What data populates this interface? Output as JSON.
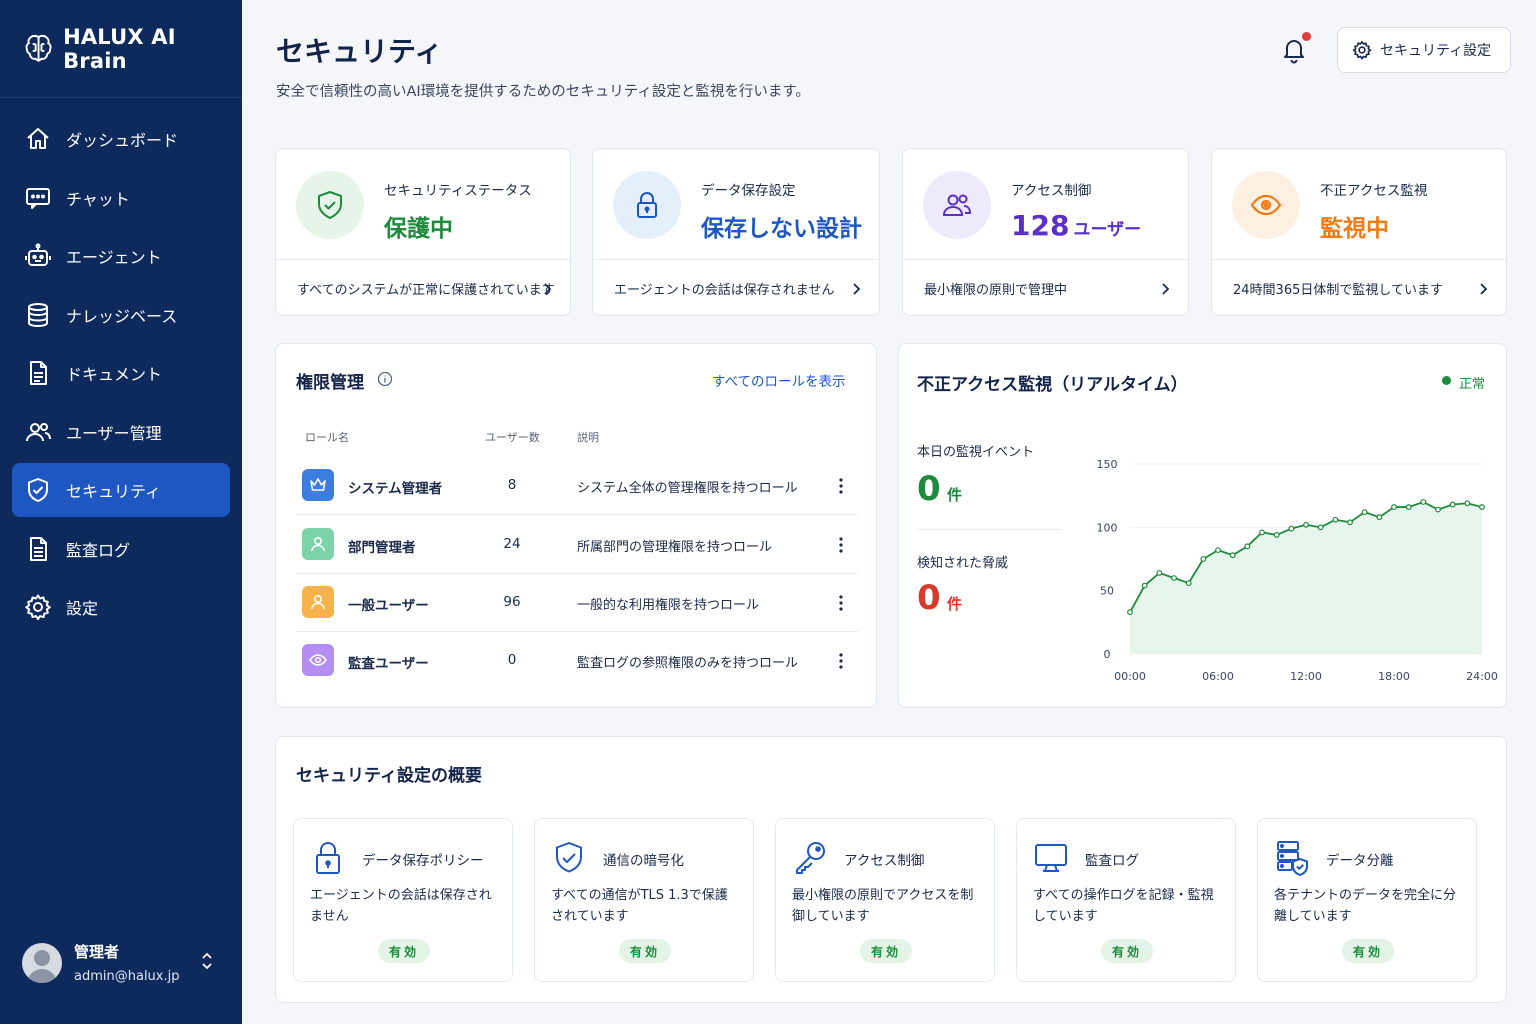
{
  "app": {
    "name": "HALUX AI Brain"
  },
  "sidebar": {
    "items": [
      {
        "label": "ダッシュボード",
        "icon": "home-icon"
      },
      {
        "label": "チャット",
        "icon": "chat-icon"
      },
      {
        "label": "エージェント",
        "icon": "robot-icon"
      },
      {
        "label": "ナレッジベース",
        "icon": "database-icon"
      },
      {
        "label": "ドキュメント",
        "icon": "document-icon"
      },
      {
        "label": "ユーザー管理",
        "icon": "users-icon"
      },
      {
        "label": "セキュリティ",
        "icon": "shield-icon",
        "active": true
      },
      {
        "label": "監査ログ",
        "icon": "log-icon"
      },
      {
        "label": "設定",
        "icon": "gear-icon"
      }
    ],
    "user": {
      "name": "管理者",
      "email": "admin@halux.jp"
    }
  },
  "header": {
    "title": "セキュリティ",
    "subtitle": "安全で信頼性の高いAI環境を提供するためのセキュリティ設定と監視を行います。",
    "settings_button": "セキュリティ設定"
  },
  "stats": [
    {
      "label": "セキュリティステータス",
      "value": "保護中",
      "unit": "",
      "footer": "すべてのシステムが正常に保護されています",
      "color": "#1e8a3c",
      "bg": "#e6f4ea",
      "icon": "shield-check-icon"
    },
    {
      "label": "データ保存設定",
      "value": "保存しない設計",
      "unit": "",
      "footer": "エージェントの会話は保存されません",
      "color": "#1f57c2",
      "bg": "#e5eefb",
      "icon": "lock-icon"
    },
    {
      "label": "アクセス制御",
      "value": "128",
      "unit": "ユーザー",
      "footer": "最小権限の原則で管理中",
      "color": "#5b2fc9",
      "bg": "#eee9fb",
      "icon": "users-icon"
    },
    {
      "label": "不正アクセス監視",
      "value": "監視中",
      "unit": "",
      "footer": "24時間365日体制で監視しています",
      "color": "#f07a14",
      "bg": "#fdf0e3",
      "icon": "eye-icon"
    }
  ],
  "roles": {
    "title": "権限管理",
    "view_all": "すべてのロールを表示",
    "headers": {
      "name": "ロール名",
      "count": "ユーザー数",
      "desc": "説明"
    },
    "rows": [
      {
        "name": "システム管理者",
        "count": "8",
        "desc": "システム全体の管理権限を持つロール",
        "color": "#3d7de0",
        "icon": "crown-icon"
      },
      {
        "name": "部門管理者",
        "count": "24",
        "desc": "所属部門の管理権限を持つロール",
        "color": "#7dd3a8",
        "icon": "user-icon"
      },
      {
        "name": "一般ユーザー",
        "count": "96",
        "desc": "一般的な利用権限を持つロール",
        "color": "#f7b24a",
        "icon": "user-icon"
      },
      {
        "name": "監査ユーザー",
        "count": "0",
        "desc": "監査ログの参照権限のみを持つロール",
        "color": "#b48ef0",
        "icon": "eye-icon"
      }
    ]
  },
  "monitor": {
    "title": "不正アクセス監視（リアルタイム）",
    "status": "正常",
    "events_label": "本日の監視イベント",
    "events_value": "0",
    "events_unit": "件",
    "threats_label": "検知された脅威",
    "threats_value": "0",
    "threats_unit": "件"
  },
  "chart_data": {
    "type": "area",
    "x": [
      0,
      1,
      2,
      3,
      4,
      5,
      6,
      7,
      8,
      9,
      10,
      11,
      12,
      13,
      14,
      15,
      16,
      17,
      18,
      19,
      20,
      21,
      22,
      23,
      24
    ],
    "xticks": [
      "00:00",
      "06:00",
      "12:00",
      "18:00",
      "24:00"
    ],
    "yticks": [
      0,
      50,
      100,
      150
    ],
    "ylim": [
      0,
      150
    ],
    "values": [
      33,
      54,
      64,
      60,
      56,
      75,
      82,
      78,
      85,
      96,
      94,
      99,
      102,
      100,
      106,
      104,
      112,
      108,
      116,
      116,
      120,
      114,
      118,
      119,
      116
    ],
    "color": "#1e8a3c",
    "fill": "#e8f5ec"
  },
  "overview": {
    "title": "セキュリティ設定の概要",
    "items": [
      {
        "title": "データ保存ポリシー",
        "desc": "エージェントの会話は保存されません",
        "badge": "有効",
        "icon": "lock-icon"
      },
      {
        "title": "通信の暗号化",
        "desc": "すべての通信がTLS 1.3で保護されています",
        "badge": "有効",
        "icon": "shield-check-icon"
      },
      {
        "title": "アクセス制御",
        "desc": "最小権限の原則でアクセスを制御しています",
        "badge": "有効",
        "icon": "key-icon"
      },
      {
        "title": "監査ログ",
        "desc": "すべての操作ログを記録・監視しています",
        "badge": "有効",
        "icon": "monitor-icon"
      },
      {
        "title": "データ分離",
        "desc": "各テナントのデータを完全に分離しています",
        "badge": "有効",
        "icon": "server-shield-icon"
      }
    ]
  }
}
